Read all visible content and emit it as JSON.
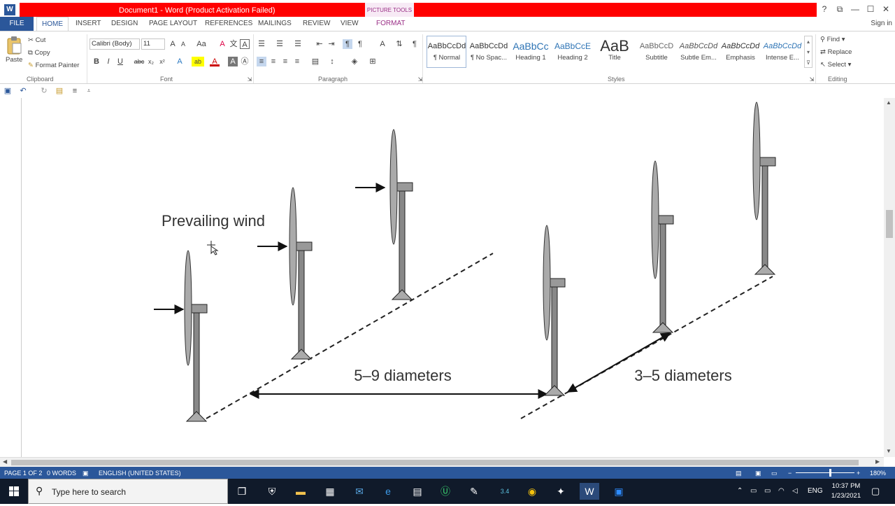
{
  "window": {
    "title": "Document1 - Word (Product Activation Failed)",
    "context_tab": "PICTURE TOOLS",
    "app_icon_letter": "W",
    "help": "?",
    "restore_ribbon": "⧉",
    "minimize": "—",
    "maximize": "☐",
    "close": "✕"
  },
  "tabs": {
    "file": "FILE",
    "items": [
      "HOME",
      "INSERT",
      "DESIGN",
      "PAGE LAYOUT",
      "REFERENCES",
      "MAILINGS",
      "REVIEW",
      "VIEW",
      "FORMAT"
    ],
    "signin": "Sign in"
  },
  "clipboard": {
    "paste": "Paste",
    "cut": "Cut",
    "copy": "Copy",
    "format_painter": "Format Painter",
    "label": "Clipboard"
  },
  "font": {
    "name": "Calibri (Body)",
    "size": "11",
    "label": "Font",
    "bold": "B",
    "italic": "I",
    "underline": "U",
    "strike": "abc",
    "sub": "x₂",
    "sup": "x²",
    "grow": "A",
    "shrink": "A",
    "case": "Aa",
    "clear": "A",
    "effects": "A",
    "highlight": "ab",
    "color": "A",
    "shade": "A",
    "enclose": "Ⓐ"
  },
  "paragraph": {
    "label": "Paragraph",
    "show_marks": "¶"
  },
  "styles": {
    "label": "Styles",
    "items": [
      {
        "preview": "AaBbCcDd",
        "name": "¶ Normal"
      },
      {
        "preview": "AaBbCcDd",
        "name": "¶ No Spac..."
      },
      {
        "preview": "AaBbCc",
        "name": "Heading 1"
      },
      {
        "preview": "AaBbCcE",
        "name": "Heading 2"
      },
      {
        "preview": "AaB",
        "name": "Title"
      },
      {
        "preview": "AaBbCcD",
        "name": "Subtitle"
      },
      {
        "preview": "AaBbCcDd",
        "name": "Subtle Em..."
      },
      {
        "preview": "AaBbCcDd",
        "name": "Emphasis"
      },
      {
        "preview": "AaBbCcDd",
        "name": "Intense E..."
      }
    ]
  },
  "editing": {
    "find": "Find",
    "replace": "Replace",
    "select": "Select",
    "label": "Editing"
  },
  "diagram": {
    "prevailing_wind": "Prevailing wind",
    "spacing_downwind": "5–9 diameters",
    "spacing_crosswind": "3–5 diameters"
  },
  "status": {
    "page": "PAGE 1 OF 2",
    "words": "0 WORDS",
    "language": "ENGLISH (UNITED STATES)",
    "zoom": "180%",
    "zoom_minus": "−",
    "zoom_plus": "+"
  },
  "taskbar": {
    "search_placeholder": "Type here to search",
    "ime": "ENG",
    "time": "10:37 PM",
    "date": "1/23/2021",
    "badge": "3.4"
  }
}
